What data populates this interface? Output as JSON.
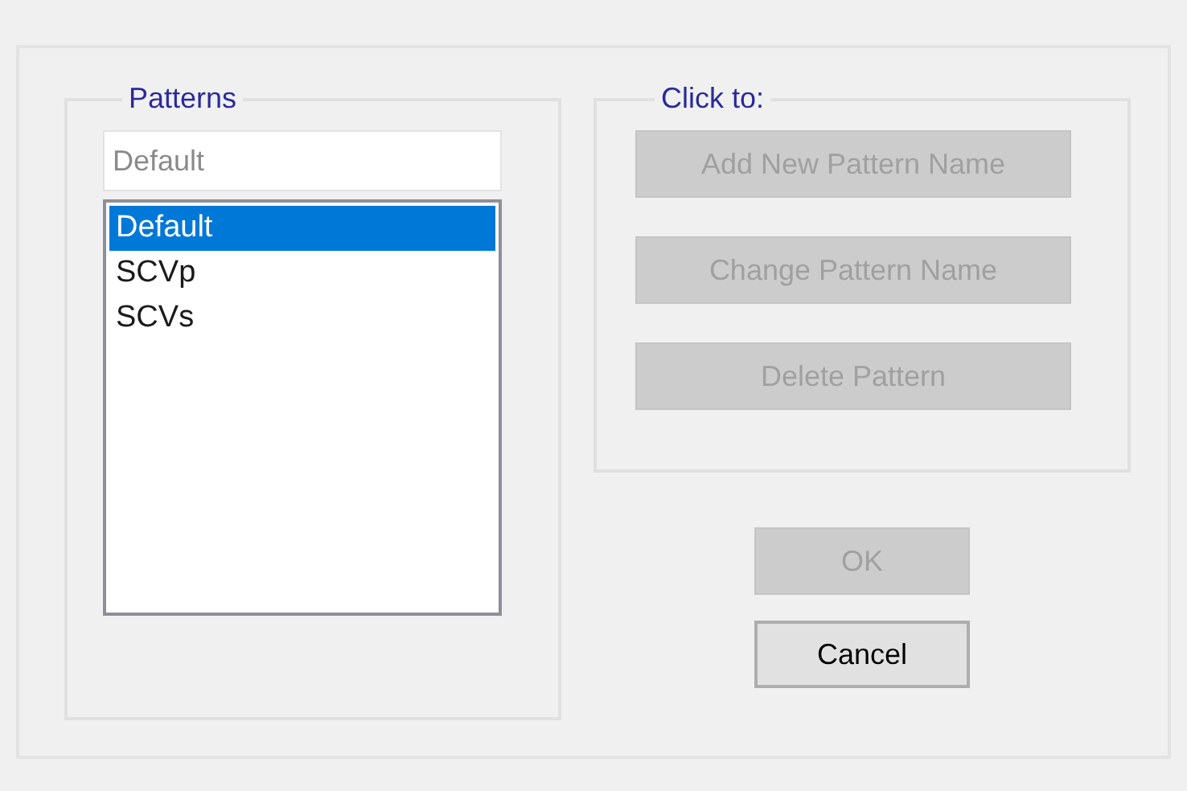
{
  "patterns": {
    "title": "Patterns",
    "name_field": {
      "value": "Default"
    },
    "items": [
      {
        "label": "Default",
        "selected": true
      },
      {
        "label": "SCVp",
        "selected": false
      },
      {
        "label": "SCVs",
        "selected": false
      }
    ]
  },
  "actions": {
    "title": "Click to:",
    "buttons": [
      {
        "label": "Add New Pattern Name",
        "disabled": true
      },
      {
        "label": "Change Pattern Name",
        "disabled": true
      },
      {
        "label": "Delete Pattern",
        "disabled": true
      }
    ]
  },
  "dialog_buttons": [
    {
      "label": "OK",
      "disabled": true
    },
    {
      "label": "Cancel",
      "disabled": false
    }
  ]
}
